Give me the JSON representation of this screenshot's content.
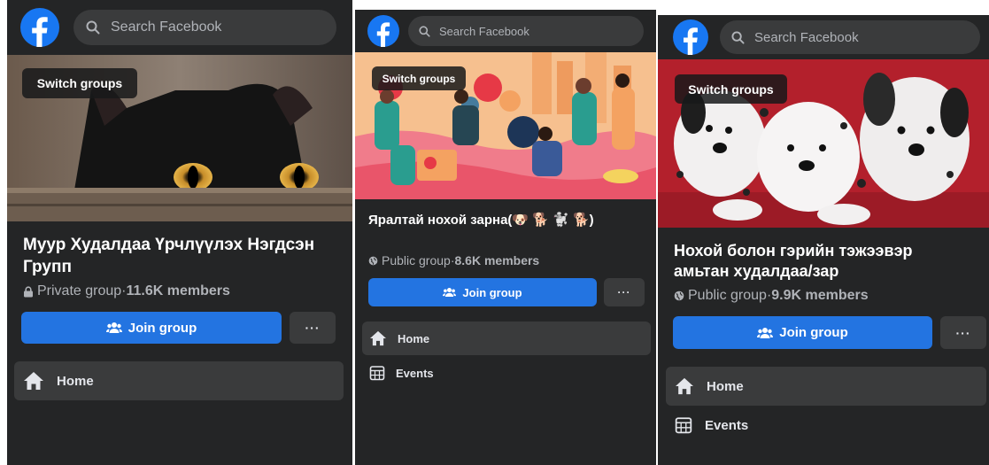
{
  "panels": [
    {
      "search_placeholder": "Search Facebook",
      "switch_label": "Switch groups",
      "title": "Муур Худалдаа Үрчлүүлэх Нэгдсэн Групп",
      "privacy": "Private group",
      "separator": " · ",
      "members": "11.6K members",
      "join_label": "Join group",
      "more_label": "···",
      "nav": [
        {
          "label": "Home",
          "icon": "home-icon"
        }
      ]
    },
    {
      "search_placeholder": "Search Facebook",
      "switch_label": "Switch groups",
      "title": "Яралтай нохой зарна(🐶 🐕 🐩 🐕)",
      "privacy": "Public group",
      "separator": " · ",
      "members": "8.6K members",
      "join_label": "Join group",
      "more_label": "···",
      "nav": [
        {
          "label": "Home",
          "icon": "home-icon"
        },
        {
          "label": "Events",
          "icon": "calendar-icon"
        }
      ]
    },
    {
      "search_placeholder": "Search Facebook",
      "switch_label": "Switch groups",
      "title": "Нохой болон гэрийн тэжээвэр амьтан худалдаа/зар",
      "privacy": "Public group",
      "separator": " · ",
      "members": "9.9K members",
      "join_label": "Join group",
      "more_label": "···",
      "nav": [
        {
          "label": "Home",
          "icon": "home-icon"
        },
        {
          "label": "Events",
          "icon": "calendar-icon"
        }
      ]
    }
  ],
  "colors": {
    "panel_bg": "#242526",
    "search_bg": "#3a3b3c",
    "accent_blue": "#2374e1",
    "brand_blue": "#1877f2",
    "text_primary": "#e4e6eb",
    "text_secondary": "#b0b3b8"
  }
}
